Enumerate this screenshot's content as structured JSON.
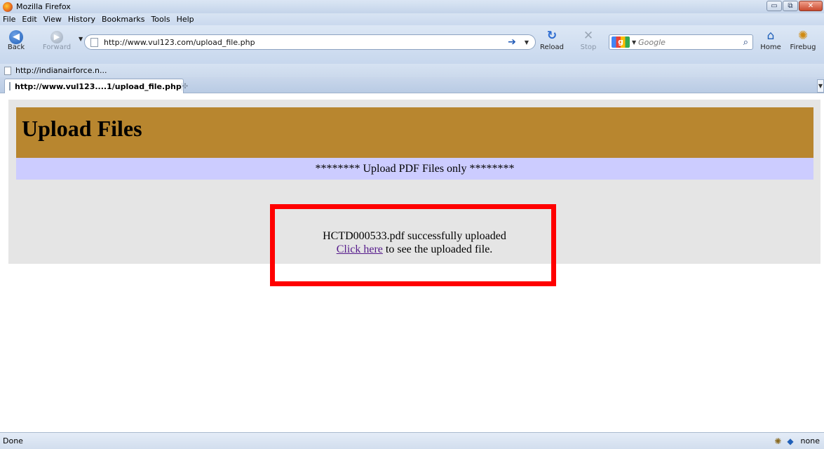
{
  "window": {
    "title": "Mozilla Firefox",
    "minimize_glyph": "▭",
    "restore_glyph": "⧉",
    "close_glyph": "✕"
  },
  "menu": [
    "File",
    "Edit",
    "View",
    "History",
    "Bookmarks",
    "Tools",
    "Help"
  ],
  "toolbar": {
    "back_label": "Back",
    "forward_label": "Forward",
    "reload_label": "Reload",
    "stop_label": "Stop",
    "home_label": "Home",
    "firebug_label": "Firebug",
    "url": "http://www.vul123.com/upload_file.php",
    "search_placeholder": "Google"
  },
  "bookmarks": {
    "item_label": "http://indianairforce.n..."
  },
  "tab": {
    "label": "http://www.vul123....1/upload_file.php",
    "new_tab_glyph": "✣"
  },
  "page": {
    "heading": "Upload Files",
    "notice": "******** Upload PDF Files only ********",
    "message_line": "HCTD000533.pdf successfully uploaded",
    "link_text": "Click here",
    "link_suffix": " to see the uploaded file."
  },
  "status": {
    "left": "Done",
    "right": "none"
  },
  "colors": {
    "header_band": "#b8862f",
    "notice_band": "#ccccff",
    "panel": "#e5e5e5",
    "highlight_box": "#ff0000",
    "link": "#551a8b"
  },
  "icons": [
    "firefox-logo-icon",
    "back-icon",
    "forward-icon",
    "reload-icon",
    "stop-icon",
    "go-arrow-icon",
    "google-logo-icon",
    "search-icon",
    "home-icon",
    "firebug-icon",
    "page-icon",
    "new-tab-icon",
    "close-icon"
  ]
}
